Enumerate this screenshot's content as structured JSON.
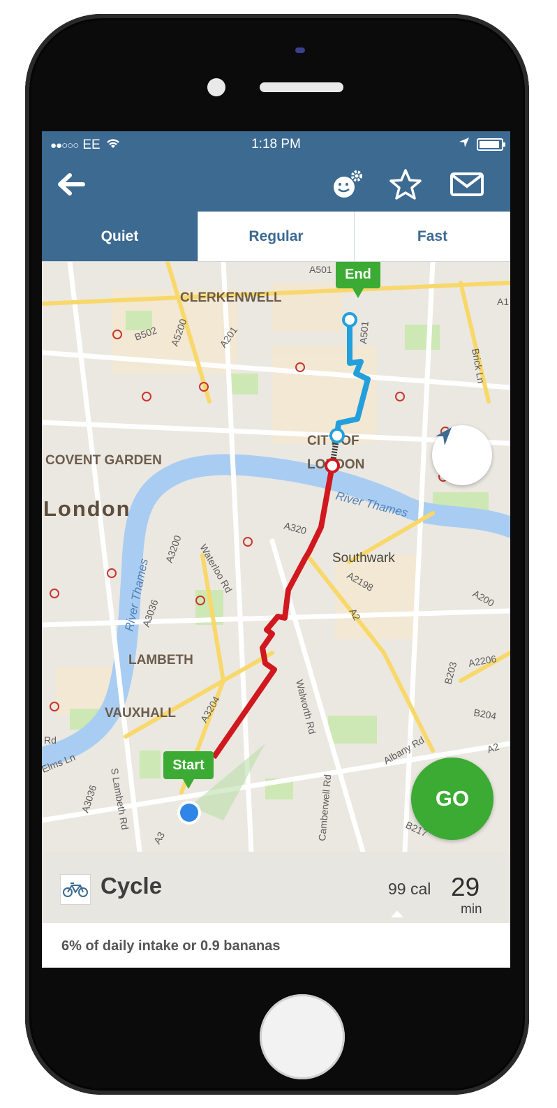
{
  "status_bar": {
    "signal": "●●○○○",
    "carrier": "EE",
    "time": "1:18 PM"
  },
  "icons": {
    "back": "back-arrow-icon",
    "settings": "face-settings-icon",
    "favourite": "star-icon",
    "share": "mail-icon",
    "locate": "navigation-arrow-icon",
    "mode": "bicycle-icon"
  },
  "tabs": [
    {
      "label": "Quiet",
      "active": true
    },
    {
      "label": "Regular",
      "active": false
    },
    {
      "label": "Fast",
      "active": false
    }
  ],
  "map": {
    "areas": [
      "CLERKENWELL",
      "COVENT GARDEN",
      "London",
      "CITY OF",
      "LONDON",
      "Southwark",
      "LAMBETH",
      "VAUXHALL"
    ],
    "rivers": [
      "River Thames",
      "River Thames"
    ],
    "roads": [
      "A501",
      "B502",
      "A5200",
      "A201",
      "A1",
      "A501",
      "Brick Ln",
      "A3200",
      "Waterloo Rd",
      "A3036",
      "A3204",
      "A2198",
      "A2",
      "A200",
      "B203",
      "A2206",
      "B204",
      "Albany Rd",
      "Walworth Rd",
      "Camberwell Rd",
      "S Lambeth Rd",
      "A3036",
      "Elms Ln",
      "Rd",
      "A3",
      "B217",
      "A2",
      "A320"
    ],
    "start_label": "Start",
    "end_label": "End"
  },
  "go_label": "GO",
  "summary": {
    "mode": "Cycle",
    "calories": "99 cal",
    "duration": "29",
    "duration_unit": "min",
    "intake": "6% of daily intake or 0.9 bananas"
  },
  "colors": {
    "header": "#3c6a91",
    "go": "#3bab33",
    "route_quiet": "#d0181f",
    "route_segment": "#23a0dc"
  }
}
